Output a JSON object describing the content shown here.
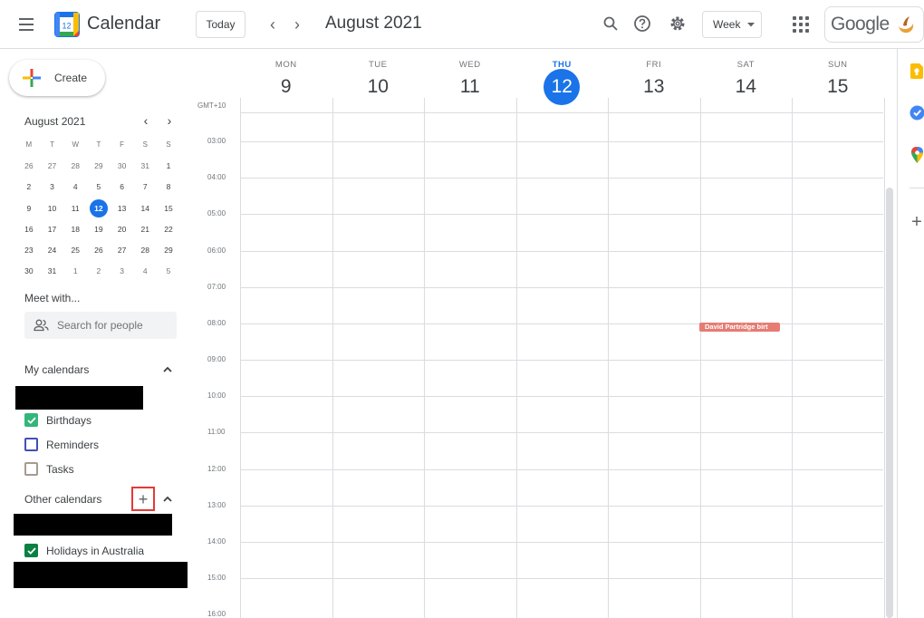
{
  "header": {
    "logo_day": "12",
    "app_title": "Calendar",
    "today_label": "Today",
    "prev_glyph": "‹",
    "next_glyph": "›",
    "current_period": "August 2021",
    "view_label": "Week",
    "brand": "Google",
    "icons": [
      "menu-icon",
      "search-icon",
      "help-icon",
      "settings-icon",
      "apps-icon"
    ]
  },
  "sidebar": {
    "create_label": "Create",
    "mini_calendar": {
      "title": "August 2021",
      "days_of_week": [
        "M",
        "T",
        "W",
        "T",
        "F",
        "S",
        "S"
      ],
      "weeks": [
        [
          "26",
          "27",
          "28",
          "29",
          "30",
          "31",
          "1"
        ],
        [
          "2",
          "3",
          "4",
          "5",
          "6",
          "7",
          "8"
        ],
        [
          "9",
          "10",
          "11",
          "12",
          "13",
          "14",
          "15"
        ],
        [
          "16",
          "17",
          "18",
          "19",
          "20",
          "21",
          "22"
        ],
        [
          "23",
          "24",
          "25",
          "26",
          "27",
          "28",
          "29"
        ],
        [
          "30",
          "31",
          "1",
          "2",
          "3",
          "4",
          "5"
        ]
      ],
      "selected_day": "12"
    },
    "meet_title": "Meet with...",
    "search_people_placeholder": "Search for people",
    "my_calendars_title": "My calendars",
    "my_calendars": [
      {
        "label": "Birthdays",
        "checked": true,
        "color": "#33b679"
      },
      {
        "label": "Reminders",
        "checked": false,
        "color": "#3f51b5"
      },
      {
        "label": "Tasks",
        "checked": false,
        "color": "#a79b8e"
      }
    ],
    "other_calendars_title": "Other calendars",
    "add_glyph": "+",
    "other_calendars": [
      {
        "label": "Holidays in Australia",
        "checked": true,
        "color": "#0b8043"
      }
    ]
  },
  "week": {
    "timezone": "GMT+10",
    "days": [
      {
        "dow": "MON",
        "num": "9"
      },
      {
        "dow": "TUE",
        "num": "10"
      },
      {
        "dow": "WED",
        "num": "11"
      },
      {
        "dow": "THU",
        "num": "12",
        "today": true
      },
      {
        "dow": "FRI",
        "num": "13"
      },
      {
        "dow": "SAT",
        "num": "14"
      },
      {
        "dow": "SUN",
        "num": "15"
      }
    ],
    "hours": [
      "03:00",
      "04:00",
      "05:00",
      "06:00",
      "07:00",
      "08:00",
      "09:00",
      "10:00",
      "11:00",
      "12:00",
      "13:00",
      "14:00",
      "15:00",
      "16:00"
    ],
    "events": [
      {
        "title": "David Partridge birt",
        "day": "SAT",
        "time": "08:00",
        "color": "#e67c73"
      }
    ]
  },
  "colors": {
    "accent": "#1a73e8",
    "today_circle": "#1a73e8",
    "event": "#e67c73"
  },
  "right_rail": {
    "icons": [
      "keep-icon",
      "tasks-icon",
      "maps-icon",
      "add-addon-icon"
    ],
    "add_glyph": "+"
  }
}
